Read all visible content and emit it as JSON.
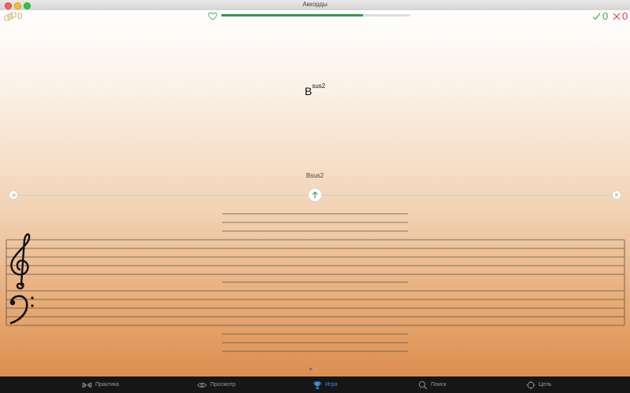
{
  "window": {
    "title": "Аккорды"
  },
  "hud": {
    "coins": "0",
    "progress": 0.75,
    "correct": "0",
    "wrong": "0"
  },
  "question": {
    "chord_root": "B",
    "chord_suffix": "sus2",
    "chord_label": "Bsus2"
  },
  "pager": {
    "count": 2,
    "active": 0
  },
  "tabbar": {
    "items": [
      {
        "label": "Практика",
        "icon": "dumbbell-icon"
      },
      {
        "label": "Просмотр",
        "icon": "eye-icon"
      },
      {
        "label": "Игра",
        "icon": "trophy-icon",
        "active": true
      },
      {
        "label": "Поиск",
        "icon": "search-icon"
      },
      {
        "label": "Цель",
        "icon": "target-icon"
      }
    ]
  },
  "colors": {
    "accent": "#3a8fe8",
    "progress": "#2e9b4a",
    "correct": "#3aa64a",
    "wrong": "#e23b3b",
    "coins": "#c8a050"
  }
}
